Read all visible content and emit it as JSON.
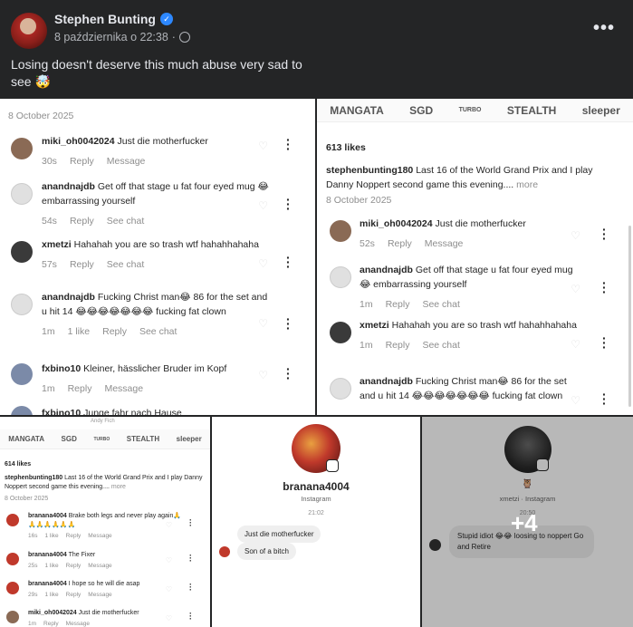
{
  "post": {
    "author": "Stephen Bunting",
    "timestamp": "8 października o 22:38",
    "privacy_separator": "·",
    "text": "Losing doesn't deserve this much abuse very sad to see 🤯",
    "more_label": "•••"
  },
  "sponsors": [
    "MANGATA",
    "SGD",
    "TURBO",
    "STEALTH",
    "sleeper"
  ],
  "tile1": {
    "date": "8 October 2025",
    "comments": [
      {
        "user": "miki_oh0042024",
        "text": "Just die motherfucker",
        "time": "30s",
        "likes": "",
        "actions": [
          "Reply",
          "Message"
        ]
      },
      {
        "user": "anandnajdb",
        "text": "Get off that stage u fat four eyed mug 😂 embarrassing yourself",
        "time": "54s",
        "likes": "",
        "actions": [
          "Reply",
          "See chat"
        ]
      },
      {
        "user": "xmetzi",
        "text": "Hahahah you are so trash wtf hahahhahaha",
        "time": "57s",
        "likes": "",
        "actions": [
          "Reply",
          "See chat"
        ]
      },
      {
        "user": "anandnajdb",
        "text": "Fucking Christ man😂 86 for the set and u hit 14 😂😂😂😂😂😂😂 fucking fat clown",
        "time": "1m",
        "likes": "1 like",
        "actions": [
          "Reply",
          "See chat"
        ]
      },
      {
        "user": "fxbino10",
        "text": "Kleiner, hässlicher Bruder im Kopf",
        "time": "1m",
        "likes": "",
        "actions": [
          "Reply",
          "Message"
        ]
      },
      {
        "user": "fxbino10",
        "text": "Junge fahr nach Hause",
        "time": "",
        "likes": "",
        "actions": []
      }
    ]
  },
  "tile2": {
    "likes": "613 likes",
    "caption_user": "stephenbunting180",
    "caption_text": "Last 16 of the World Grand Prix and I play Danny Noppert second game this evening....",
    "more": "more",
    "date": "8 October 2025",
    "comments": [
      {
        "user": "miki_oh0042024",
        "text": "Just die motherfucker",
        "time": "52s",
        "actions": [
          "Reply",
          "Message"
        ]
      },
      {
        "user": "anandnajdb",
        "text": "Get off that stage u fat four eyed mug 😂 embarrassing yourself",
        "time": "1m",
        "actions": [
          "Reply",
          "See chat"
        ]
      },
      {
        "user": "xmetzi",
        "text": "Hahahah you are so trash wtf hahahhahaha",
        "time": "1m",
        "actions": [
          "Reply",
          "See chat"
        ]
      },
      {
        "user": "anandnajdb",
        "text": "Fucking Christ man😂 86 for the set and u hit 14 😂😂😂😂😂😂😂 fucking fat clown",
        "time": "",
        "actions": []
      }
    ]
  },
  "tile3": {
    "top_label": "Andy Fich",
    "likes": "614 likes",
    "caption_user": "stephenbunting180",
    "caption_text": "Last 16 of the World Grand Prix and I play Danny Noppert second game this evening....",
    "more": "more",
    "date": "8 October 2025",
    "comments": [
      {
        "user": "branana4004",
        "text": "Brake both legs and never play again🙏🙏🙏🙏🙏🙏🙏",
        "time": "16s",
        "likes": "1 like",
        "actions": [
          "Reply",
          "Message"
        ]
      },
      {
        "user": "branana4004",
        "text": "The Fixer",
        "time": "25s",
        "likes": "1 like",
        "actions": [
          "Reply",
          "Message"
        ]
      },
      {
        "user": "branana4004",
        "text": "I hope so he will die asap",
        "time": "29s",
        "likes": "1 like",
        "actions": [
          "Reply",
          "Message"
        ]
      },
      {
        "user": "miki_oh0042024",
        "text": "Just die motherfucker",
        "time": "1m",
        "likes": "",
        "actions": [
          "Reply",
          "Message"
        ]
      }
    ]
  },
  "tile4": {
    "name": "branana4004",
    "sub": "Instagram",
    "time": "21:02",
    "messages": [
      "Just die motherfucker",
      "Son of a bitch"
    ]
  },
  "tile5": {
    "emoji": "🦉",
    "sub": "xmetzi · Instagram",
    "time": "20:50",
    "message": "Stupid idiot 😂😂 loosing to noppert Go and Retire",
    "overlay": "+4"
  }
}
